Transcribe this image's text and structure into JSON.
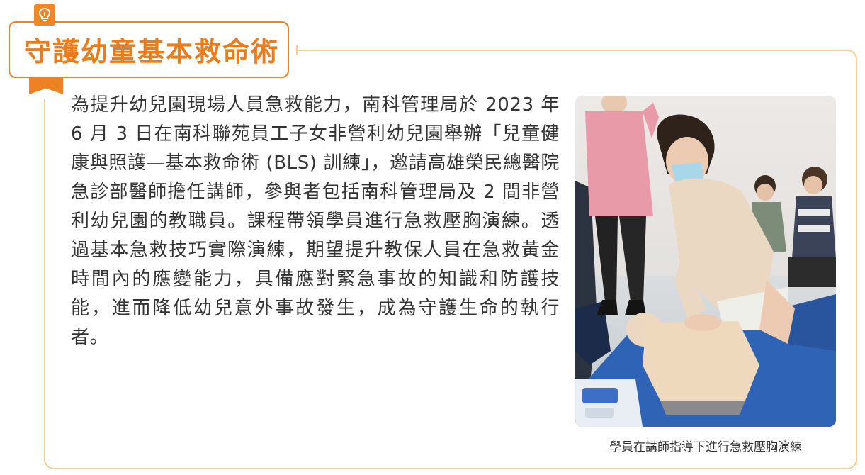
{
  "header": {
    "title": "守護幼童基本救命術",
    "badge_icon": "lightbulb-icon"
  },
  "body": {
    "paragraph": "為提升幼兒園現場人員急救能力，南科管理局於 2023 年 6 月 3 日在南科聯苑員工子女非營利幼兒園舉辦「兒童健康與照護—基本救命術 (BLS) 訓練」，邀請高雄榮民總醫院急診部醫師擔任講師，參與者包括南科管理局及 2 間非營利幼兒園的教職員。課程帶領學員進行急救壓胸演練。透過基本急救技巧實際演練，期望提升教保人員在急救黃金時間內的應變能力，具備應對緊急事故的知識和防護技能，進而降低幼兒意外事故發生，成為守護生命的執行者。"
  },
  "photo": {
    "caption": "學員在講師指導下進行急救壓胸演練"
  },
  "colors": {
    "accent": "#ed8222",
    "border": "#f6cd93",
    "text": "#333333"
  }
}
